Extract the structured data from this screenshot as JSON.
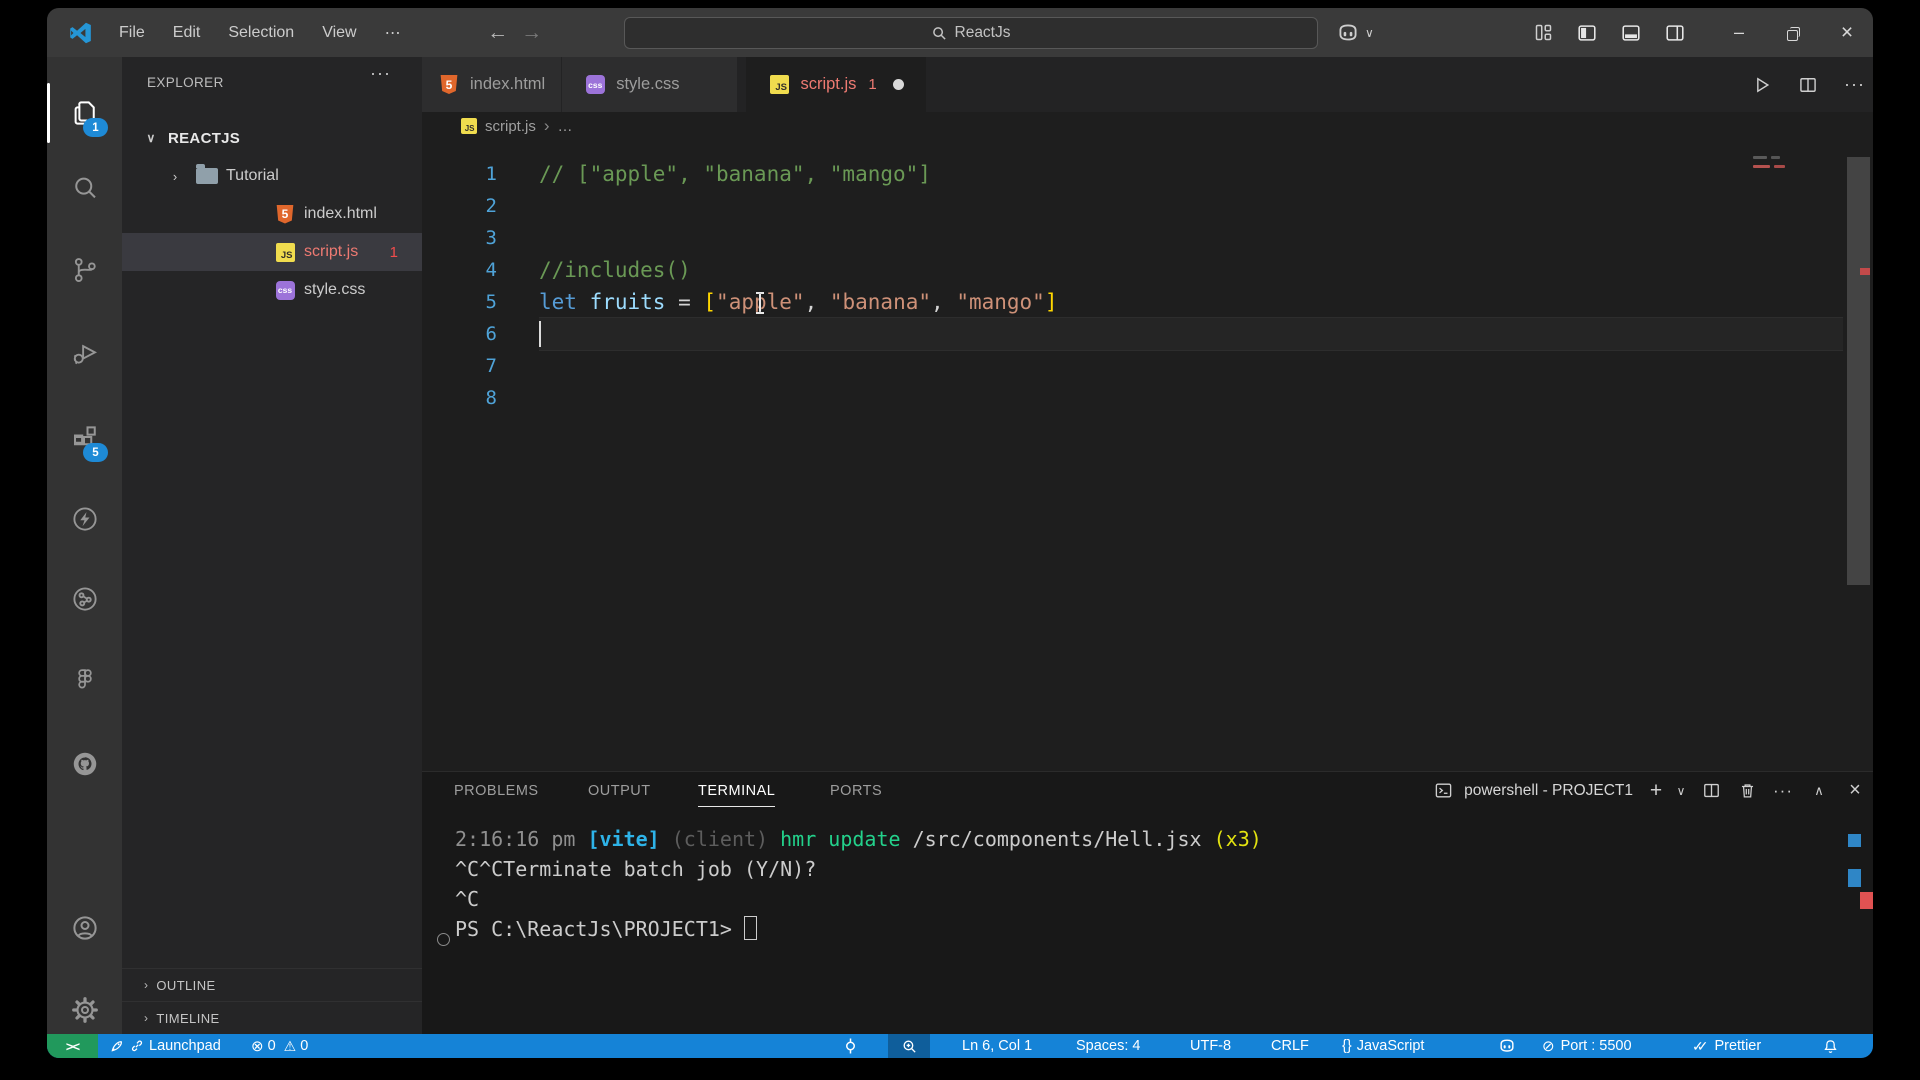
{
  "title_bar": {
    "menus": [
      "File",
      "Edit",
      "Selection",
      "View",
      "⋯"
    ],
    "search_value": "ReactJs"
  },
  "activity_bar": {
    "explorer_badge": "1",
    "extensions_badge": "5"
  },
  "explorer": {
    "header": "EXPLORER",
    "header_more": "···",
    "section": "REACTJS",
    "items": [
      {
        "label": "Tutorial",
        "type": "folder",
        "selected": false,
        "badge": ""
      },
      {
        "label": "index.html",
        "type": "html",
        "selected": false,
        "badge": ""
      },
      {
        "label": "script.js",
        "type": "js",
        "selected": true,
        "badge": "1",
        "error": true
      },
      {
        "label": "style.css",
        "type": "css",
        "selected": false,
        "badge": ""
      }
    ],
    "bottom_sections": [
      "OUTLINE",
      "TIMELINE"
    ]
  },
  "editor_tabs": [
    {
      "label": "index.html",
      "type": "html"
    },
    {
      "label": "style.css",
      "type": "css"
    },
    {
      "label": "script.js",
      "type": "js",
      "badge": "1"
    }
  ],
  "breadcrumb": {
    "file": "script.js",
    "separator": "›",
    "more": "…"
  },
  "editor": {
    "cursor_line": 6,
    "lines": [
      {
        "n": "1",
        "tokens": [
          [
            "comment",
            "// [\"apple\", \"banana\", \"mango\"]"
          ]
        ]
      },
      {
        "n": "2",
        "tokens": []
      },
      {
        "n": "3",
        "tokens": []
      },
      {
        "n": "4",
        "tokens": [
          [
            "comment",
            "//includes()"
          ]
        ]
      },
      {
        "n": "5",
        "tokens": [
          [
            "kw",
            "let "
          ],
          [
            "var",
            "fruits "
          ],
          [
            "op",
            "= "
          ],
          [
            "br",
            "["
          ],
          [
            "str",
            "\"apple\""
          ],
          [
            "op",
            ", "
          ],
          [
            "str",
            "\"banana\""
          ],
          [
            "op",
            ", "
          ],
          [
            "str",
            "\"mango\""
          ],
          [
            "br",
            "]"
          ]
        ]
      },
      {
        "n": "6",
        "tokens": []
      },
      {
        "n": "7",
        "tokens": []
      },
      {
        "n": "8",
        "tokens": []
      }
    ]
  },
  "panel": {
    "tabs": [
      "PROBLEMS",
      "OUTPUT",
      "TERMINAL",
      "PORTS"
    ],
    "active_tab": "TERMINAL",
    "terminal_title": "powershell - PROJECT1",
    "terminal_lines": [
      [
        [
          "dim",
          "2:16:16 pm "
        ],
        [
          "vite",
          "[vite] "
        ],
        [
          "faint",
          "(client) "
        ],
        [
          "green",
          "hmr update "
        ],
        [
          "fg",
          "/src/components/Hell.jsx "
        ],
        [
          "yellow",
          "(x3)"
        ]
      ],
      [
        [
          "fg",
          "^C^CTerminate batch job (Y/N)?"
        ]
      ],
      [
        [
          "fg",
          "^C"
        ]
      ],
      [
        [
          "fg",
          "PS C:\\ReactJs\\PROJECT1> "
        ]
      ]
    ]
  },
  "status_bar": {
    "launchpad": "Launchpad",
    "errors": "0",
    "warnings": "0",
    "line_col": "Ln 6, Col 1",
    "spaces": "Spaces: 4",
    "encoding": "UTF-8",
    "eol": "CRLF",
    "braces": "{ }",
    "language": "JavaScript",
    "port": "Port : 5500",
    "formatter": "Prettier"
  },
  "colors": {
    "status_bar": "#1583d7",
    "remote_green": "#21995c",
    "error_red": "#f14c4c",
    "badge_blue": "#1e8ad6",
    "string_orange": "#ce9178",
    "comment_green": "#6a9955"
  }
}
